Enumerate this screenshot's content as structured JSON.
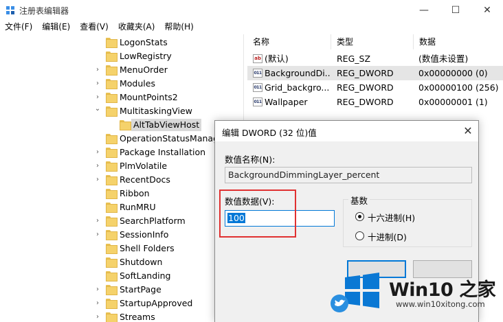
{
  "window": {
    "title": "注册表编辑器",
    "minimize_glyph": "—",
    "maximize_glyph": "☐",
    "close_glyph": "✕"
  },
  "menu": [
    "文件(F)",
    "编辑(E)",
    "查看(V)",
    "收藏夹(A)",
    "帮助(H)"
  ],
  "tree": {
    "items": [
      {
        "label": "LogonStats",
        "expandable": false
      },
      {
        "label": "LowRegistry",
        "expandable": false
      },
      {
        "label": "MenuOrder",
        "expandable": true
      },
      {
        "label": "Modules",
        "expandable": true
      },
      {
        "label": "MountPoints2",
        "expandable": true
      },
      {
        "label": "MultitaskingView",
        "expandable": true,
        "expanded": true
      },
      {
        "label": "AltTabViewHost",
        "child": true,
        "selected": true
      },
      {
        "label": "OperationStatusManage",
        "expandable": false
      },
      {
        "label": "Package Installation",
        "expandable": true
      },
      {
        "label": "PlmVolatile",
        "expandable": true
      },
      {
        "label": "RecentDocs",
        "expandable": true
      },
      {
        "label": "Ribbon",
        "expandable": false
      },
      {
        "label": "RunMRU",
        "expandable": false
      },
      {
        "label": "SearchPlatform",
        "expandable": true
      },
      {
        "label": "SessionInfo",
        "expandable": true
      },
      {
        "label": "Shell Folders",
        "expandable": false
      },
      {
        "label": "Shutdown",
        "expandable": false
      },
      {
        "label": "SoftLanding",
        "expandable": false
      },
      {
        "label": "StartPage",
        "expandable": true
      },
      {
        "label": "StartupApproved",
        "expandable": true
      },
      {
        "label": "Streams",
        "expandable": true
      }
    ],
    "chevron_collapsed": "›",
    "chevron_expanded": "⌄"
  },
  "list": {
    "columns": [
      "名称",
      "类型",
      "数据"
    ],
    "rows": [
      {
        "name": "(默认)",
        "type": "REG_SZ",
        "data": "(数值未设置)",
        "icon": "ab",
        "selected": false
      },
      {
        "name": "BackgroundDi...",
        "type": "REG_DWORD",
        "data": "0x00000000 (0)",
        "icon": "bin",
        "selected": true
      },
      {
        "name": "Grid_backgro...",
        "type": "REG_DWORD",
        "data": "0x00000100 (256)",
        "icon": "bin",
        "selected": false
      },
      {
        "name": "Wallpaper",
        "type": "REG_DWORD",
        "data": "0x00000001 (1)",
        "icon": "bin",
        "selected": false
      }
    ]
  },
  "dialog": {
    "title": "编辑 DWORD (32 位)值",
    "close_glyph": "✕",
    "name_label": "数值名称(N):",
    "name_value": "BackgroundDimmingLayer_percent",
    "data_label": "数值数据(V):",
    "data_value": "100",
    "base_label": "基数",
    "hex_label": "十六进制(H)",
    "dec_label": "十进制(D)",
    "selected_base": "hex"
  },
  "watermark": {
    "brand": "Win10 之家",
    "url": "www.win10xitong.com"
  },
  "colors": {
    "accent": "#0078d7",
    "highlight_box": "#e03030",
    "folder": "#f5d26b",
    "watermark_logo": "#0a78d4"
  }
}
